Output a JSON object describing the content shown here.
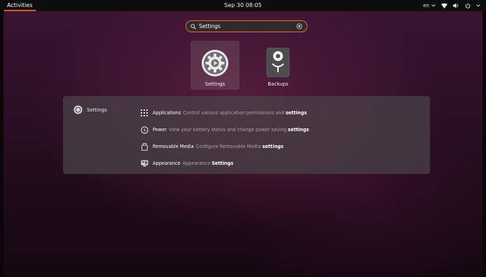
{
  "topbar": {
    "activities": "Activities",
    "clock": "Sep 30  08:05",
    "keyboard_layout": "en",
    "tray_icons": [
      "chevron-down-icon",
      "wifi-icon",
      "volume-icon",
      "power-icon",
      "chevron-down-icon"
    ]
  },
  "search": {
    "value": "Settings",
    "icon": "search-icon",
    "clear_icon": "clear-icon",
    "accent_color": "#e9683a"
  },
  "apps": [
    {
      "label": "Settings",
      "icon": "settings-gear-icon"
    },
    {
      "label": "Backups",
      "icon": "backups-icon"
    }
  ],
  "results": {
    "provider": {
      "label": "Settings",
      "icon": "settings-icon"
    },
    "rows": [
      {
        "name": "Applications",
        "desc": "Control various application permissions and",
        "highlight": "settings",
        "icon": "grid-icon"
      },
      {
        "name": "Power",
        "desc": "View your battery status and change power saving",
        "highlight": "settings",
        "icon": "power-icon"
      },
      {
        "name": "Removable Media",
        "desc": "Configure Removable Media",
        "highlight": "settings",
        "icon": "removable-media-icon"
      },
      {
        "name": "Appearance",
        "desc": "Appearance",
        "highlight": "Settings",
        "icon": "appearance-icon"
      }
    ]
  }
}
